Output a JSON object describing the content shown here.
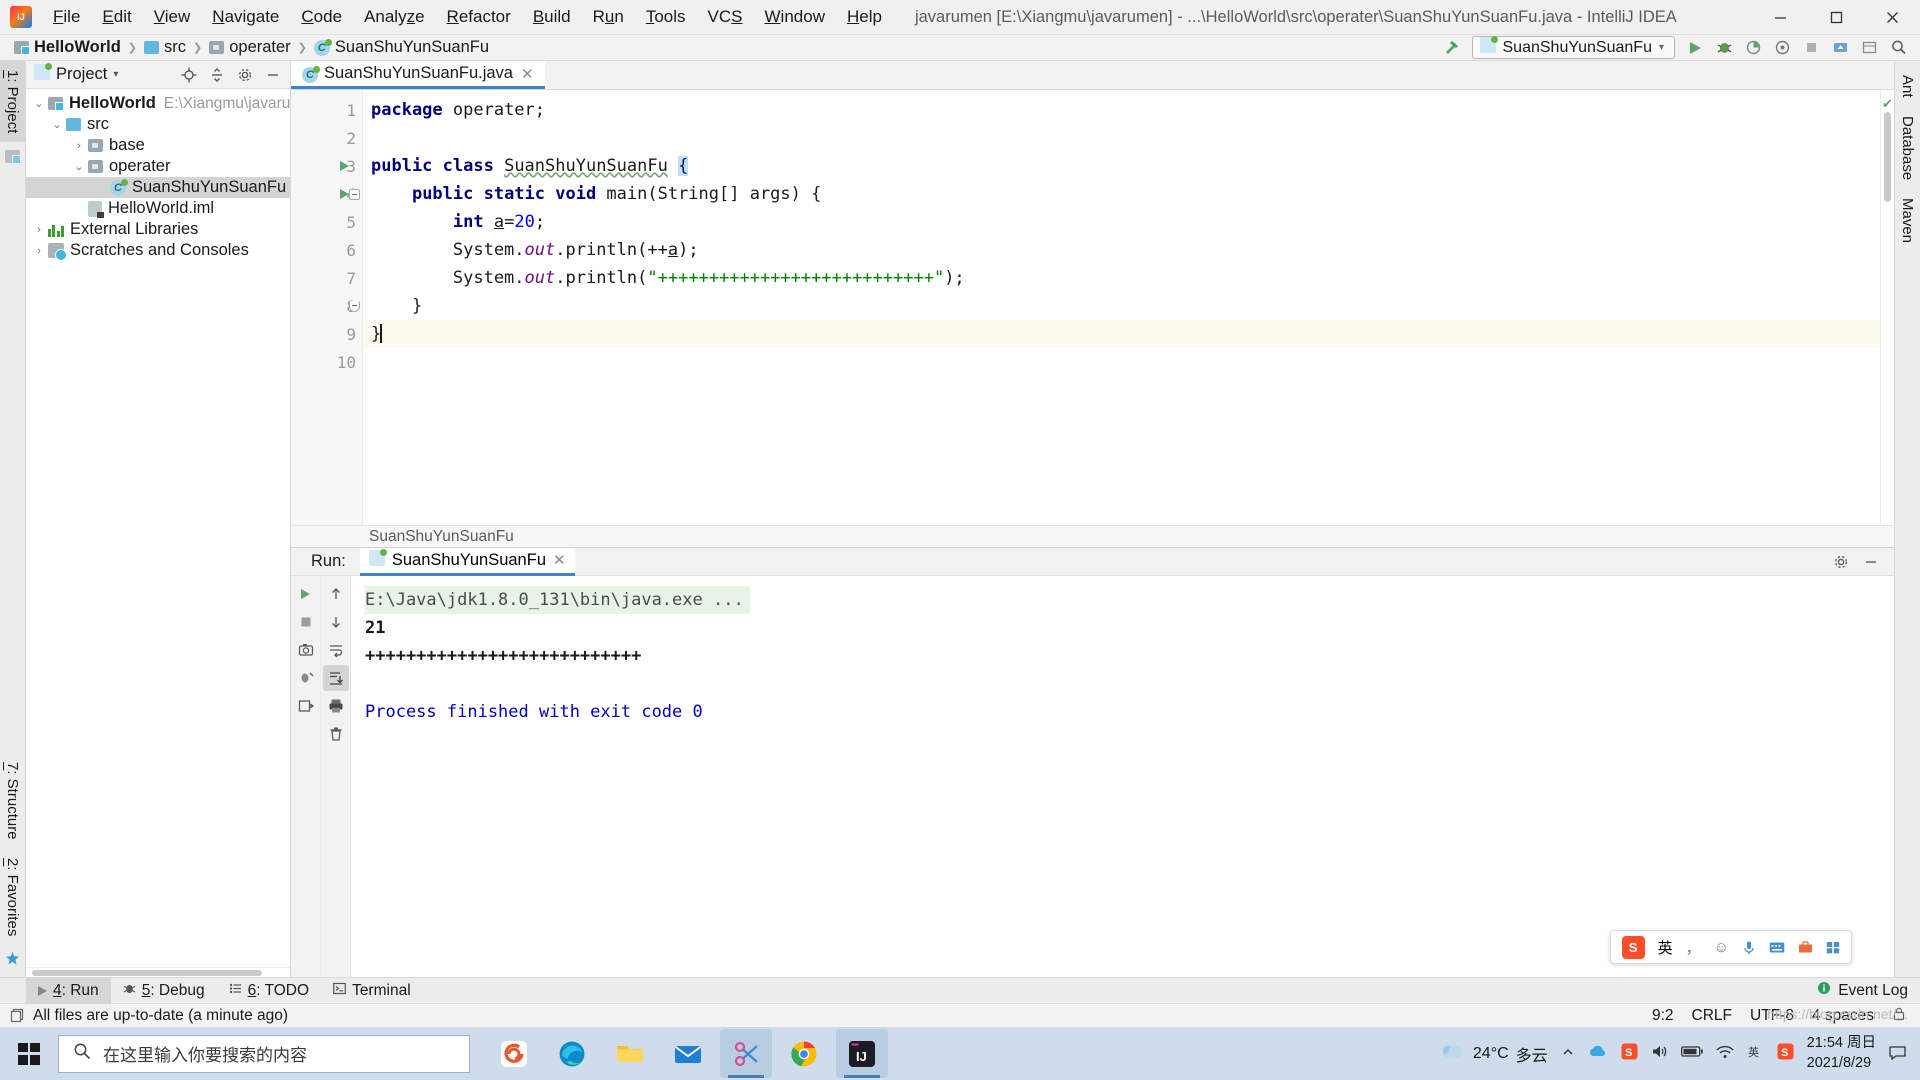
{
  "titlebar": {
    "logo": "intellij-logo",
    "menus": [
      "File",
      "Edit",
      "View",
      "Navigate",
      "Code",
      "Analyze",
      "Refactor",
      "Build",
      "Run",
      "Tools",
      "VCS",
      "Window",
      "Help"
    ],
    "window_title": "javarumen [E:\\Xiangmu\\javarumen] - ...\\HelloWorld\\src\\operater\\SuanShuYunSuanFu.java - IntelliJ IDEA",
    "minimize": "—",
    "maximize": "▢",
    "close": "✕"
  },
  "navbar": {
    "crumbs": [
      {
        "label": "HelloWorld",
        "icon": "module-folder-icon",
        "bold": true
      },
      {
        "label": "src",
        "icon": "source-folder-icon",
        "bold": false
      },
      {
        "label": "operater",
        "icon": "package-folder-icon",
        "bold": false
      },
      {
        "label": "SuanShuYunSuanFu",
        "icon": "java-class-icon",
        "bold": false
      }
    ],
    "run_config": "SuanShuYunSuanFu",
    "buttons": [
      "run-button",
      "debug-button",
      "run-with-coverage-button",
      "profile-button",
      "stop-button",
      "update-button",
      "settings-button",
      "search-everywhere-button"
    ]
  },
  "left_rail": {
    "project_tab": "1: Project",
    "structure_tab": "7: Structure",
    "favorites_tab": "2: Favorites"
  },
  "right_rail": {
    "tabs": [
      "Ant",
      "Database",
      "Maven"
    ]
  },
  "project_panel": {
    "title": "Project",
    "tree": [
      {
        "label": "HelloWorld",
        "path": "E:\\Xiangmu\\javarumen\\He",
        "depth": 0,
        "twisty": "▾",
        "icon": "module-folder-icon",
        "bold": true,
        "selected": false
      },
      {
        "label": "src",
        "path": "",
        "depth": 1,
        "twisty": "▾",
        "icon": "source-folder-icon",
        "bold": false,
        "selected": false
      },
      {
        "label": "base",
        "path": "",
        "depth": 2,
        "twisty": "›",
        "icon": "package-folder-icon",
        "bold": false,
        "selected": false
      },
      {
        "label": "operater",
        "path": "",
        "depth": 2,
        "twisty": "▾",
        "icon": "package-folder-icon",
        "bold": false,
        "selected": false
      },
      {
        "label": "SuanShuYunSuanFu",
        "path": "",
        "depth": 3,
        "twisty": "",
        "icon": "java-class-icon",
        "bold": false,
        "selected": true
      },
      {
        "label": "HelloWorld.iml",
        "path": "",
        "depth": 2,
        "twisty": "",
        "icon": "iml-file-icon",
        "bold": false,
        "selected": false
      },
      {
        "label": "External Libraries",
        "path": "",
        "depth": 0,
        "twisty": "›",
        "icon": "libraries-icon",
        "bold": false,
        "selected": false
      },
      {
        "label": "Scratches and Consoles",
        "path": "",
        "depth": 0,
        "twisty": "›",
        "icon": "scratches-icon",
        "bold": false,
        "selected": false
      }
    ]
  },
  "editor": {
    "tab_label": "SuanShuYunSuanFu.java",
    "tab_close": "✕",
    "breadcrumb": "SuanShuYunSuanFu",
    "line_numbers": [
      "1",
      "2",
      "3",
      "4",
      "5",
      "6",
      "7",
      "8",
      "9",
      "10"
    ],
    "code_lines": [
      {
        "n": 1,
        "segments": [
          {
            "t": "package ",
            "c": "kw"
          },
          {
            "t": "operater;",
            "c": ""
          }
        ]
      },
      {
        "n": 2,
        "segments": []
      },
      {
        "n": 3,
        "segments": [
          {
            "t": "public class ",
            "c": "kw"
          },
          {
            "t": "SuanShuYunSuanFu",
            "c": "squiggle"
          },
          {
            "t": " ",
            "c": ""
          },
          {
            "t": "{",
            "c": "hl-brace"
          }
        ]
      },
      {
        "n": 4,
        "segments": [
          {
            "t": "    ",
            "c": ""
          },
          {
            "t": "public static void ",
            "c": "kw"
          },
          {
            "t": "main(String[] args) {",
            "c": ""
          }
        ]
      },
      {
        "n": 5,
        "segments": [
          {
            "t": "        ",
            "c": ""
          },
          {
            "t": "int ",
            "c": "kw"
          },
          {
            "t": "a",
            "c": "var-u"
          },
          {
            "t": "=",
            "c": ""
          },
          {
            "t": "20",
            "c": "num"
          },
          {
            "t": ";",
            "c": ""
          }
        ]
      },
      {
        "n": 6,
        "segments": [
          {
            "t": "        System.",
            "c": ""
          },
          {
            "t": "out",
            "c": "fld"
          },
          {
            "t": ".println(++",
            "c": ""
          },
          {
            "t": "a",
            "c": "var-u"
          },
          {
            "t": ");",
            "c": ""
          }
        ]
      },
      {
        "n": 7,
        "segments": [
          {
            "t": "        System.",
            "c": ""
          },
          {
            "t": "out",
            "c": "fld"
          },
          {
            "t": ".println(",
            "c": ""
          },
          {
            "t": "\"+++++++++++++++++++++++++++\"",
            "c": "str"
          },
          {
            "t": ");",
            "c": ""
          }
        ]
      },
      {
        "n": 8,
        "segments": [
          {
            "t": "    }",
            "c": ""
          }
        ]
      },
      {
        "n": 9,
        "segments": [
          {
            "t": "}",
            "c": ""
          }
        ],
        "caret": true
      },
      {
        "n": 10,
        "segments": []
      }
    ]
  },
  "run_window": {
    "label": "Run:",
    "tab": "SuanShuYunSuanFu",
    "tab_close": "✕",
    "toolbar_left": [
      "rerun-button",
      "stop-button",
      "screenshot-button",
      "thread-dump-button",
      "export-button"
    ],
    "toolbar_right": [
      "scroll-up-button",
      "scroll-down-button",
      "soft-wrap-button",
      "scroll-to-end-button",
      "print-button",
      "clear-all-button"
    ],
    "settings_icon": "gear-icon",
    "hide_icon": "minimize-icon",
    "console": [
      {
        "text": "E:\\Java\\jdk1.8.0_131\\bin\\java.exe ...",
        "style": "cmd"
      },
      {
        "text": "21",
        "style": "outval"
      },
      {
        "text": "+++++++++++++++++++++++++++",
        "style": "plus"
      },
      {
        "text": "",
        "style": ""
      },
      {
        "text": "Process finished with exit code 0",
        "style": "done"
      }
    ]
  },
  "bottom_tabs": [
    {
      "label": "4: Run",
      "icon": "run-icon",
      "active": true
    },
    {
      "label": "5: Debug",
      "icon": "debug-icon",
      "active": false
    },
    {
      "label": "6: TODO",
      "icon": "todo-icon",
      "active": false
    },
    {
      "label": "Terminal",
      "icon": "terminal-icon",
      "active": false
    }
  ],
  "bottom_right": {
    "event_log": "Event Log",
    "event_log_icon": "info-icon"
  },
  "statusbar": {
    "message": "All files are up-to-date (a minute ago)",
    "message_icon": "files-icon",
    "caret_position": "9:2",
    "line_separator": "CRLF",
    "encoding": "UTF-8",
    "indent": "4 spaces",
    "lock_icon": "lock-icon"
  },
  "ime_bar": {
    "logo": "sogou-icon",
    "mode": "英",
    "items": [
      "comma-icon",
      "smiley-icon",
      "mic-icon",
      "keyboard-icon",
      "toolbox-icon",
      "menu-icon"
    ]
  },
  "watermark": "https://blog.csdn.net/...",
  "taskbar": {
    "start": "windows-start-icon",
    "search_placeholder": "在这里输入你要搜索的内容",
    "search_icon": "search-icon",
    "apps": [
      {
        "name": "sogou-pinyin-icon",
        "active": false
      },
      {
        "name": "microsoft-edge-icon",
        "active": false
      },
      {
        "name": "file-explorer-icon",
        "active": false
      },
      {
        "name": "mail-icon",
        "active": false
      },
      {
        "name": "snipaste-icon",
        "active": true
      },
      {
        "name": "google-chrome-icon",
        "active": false
      },
      {
        "name": "intellij-idea-icon",
        "active": true
      }
    ],
    "tray": {
      "weather_temp": "24°C",
      "weather_desc": "多云",
      "weather_icon": "cloud-icon",
      "icons": [
        "chevron-up-icon",
        "cloud-sync-icon",
        "sogou-tray-icon",
        "volume-icon",
        "battery-icon",
        "network-icon",
        "ime-icon",
        "sogou-icon",
        "notification-icon"
      ],
      "time": "21:54 周日",
      "date": "2021/8/29"
    }
  }
}
